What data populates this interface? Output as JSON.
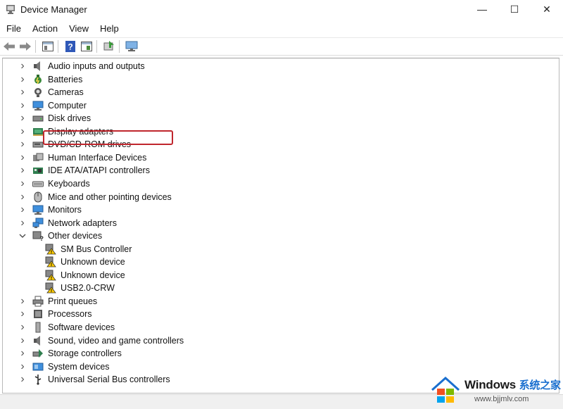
{
  "window": {
    "title": "Device Manager",
    "minimize_glyph": "—",
    "maximize_glyph": "☐",
    "close_glyph": "✕"
  },
  "menu": [
    "File",
    "Action",
    "View",
    "Help"
  ],
  "toolbar_icons": [
    "back-arrow-icon",
    "forward-arrow-icon",
    "properties-icon",
    "help-icon",
    "driver-details-icon",
    "update-driver-icon",
    "scan-hardware-icon"
  ],
  "tree": {
    "items": [
      {
        "label": "Audio inputs and outputs",
        "icon": "speaker-icon",
        "expanded": false
      },
      {
        "label": "Batteries",
        "icon": "battery-icon",
        "expanded": false
      },
      {
        "label": "Cameras",
        "icon": "camera-icon",
        "expanded": false
      },
      {
        "label": "Computer",
        "icon": "monitor-icon",
        "expanded": false
      },
      {
        "label": "Disk drives",
        "icon": "disk-drive-icon",
        "expanded": false
      },
      {
        "label": "Display adapters",
        "icon": "display-adapter-icon",
        "expanded": false
      },
      {
        "label": "DVD/CD-ROM drives",
        "icon": "dvd-drive-icon",
        "expanded": false
      },
      {
        "label": "Human Interface Devices",
        "icon": "hid-icon",
        "expanded": false
      },
      {
        "label": "IDE ATA/ATAPI controllers",
        "icon": "ide-controller-icon",
        "expanded": false
      },
      {
        "label": "Keyboards",
        "icon": "keyboard-icon",
        "expanded": false
      },
      {
        "label": "Mice and other pointing devices",
        "icon": "mouse-icon",
        "expanded": false,
        "highlighted": true
      },
      {
        "label": "Monitors",
        "icon": "monitor-icon",
        "expanded": false
      },
      {
        "label": "Network adapters",
        "icon": "network-adapter-icon",
        "expanded": false
      },
      {
        "label": "Other devices",
        "icon": "other-devices-icon",
        "expanded": true
      }
    ],
    "other_devices_children": [
      {
        "label": "SM Bus Controller",
        "icon": "warning-device-icon"
      },
      {
        "label": "Unknown device",
        "icon": "warning-device-icon"
      },
      {
        "label": "Unknown device",
        "icon": "warning-device-icon"
      },
      {
        "label": "USB2.0-CRW",
        "icon": "warning-device-icon"
      }
    ],
    "items_after": [
      {
        "label": "Print queues",
        "icon": "printer-icon",
        "expanded": false
      },
      {
        "label": "Processors",
        "icon": "processor-icon",
        "expanded": false
      },
      {
        "label": "Software devices",
        "icon": "software-device-icon",
        "expanded": false
      },
      {
        "label": "Sound, video and game controllers",
        "icon": "speaker-icon",
        "expanded": false
      },
      {
        "label": "Storage controllers",
        "icon": "storage-controller-icon",
        "expanded": false
      },
      {
        "label": "System devices",
        "icon": "system-device-icon",
        "expanded": false
      },
      {
        "label": "Universal Serial Bus controllers",
        "icon": "usb-icon",
        "expanded": false
      }
    ]
  },
  "watermark": {
    "brand": "Windows",
    "cn": "系统之家",
    "url": "www.bjjmlv.com"
  },
  "colors": {
    "highlight_border": "#c0262d",
    "accent_blue": "#1a6fcf"
  }
}
